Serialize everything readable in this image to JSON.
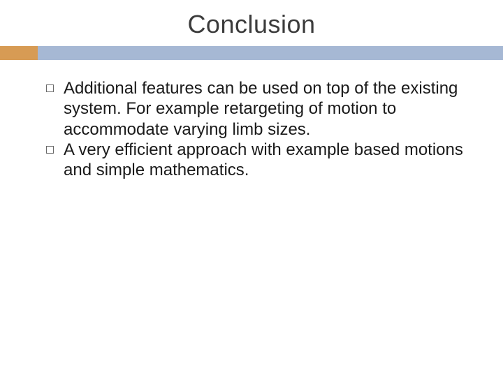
{
  "slide": {
    "title": "Conclusion",
    "bullets": [
      "Additional features can be used on top of the existing system. For example retargeting of motion to accommodate varying limb sizes.",
      "A very efficient approach with example based motions and simple mathematics."
    ]
  },
  "colors": {
    "accent": "#d79b54",
    "bar": "#a6b8d4"
  }
}
